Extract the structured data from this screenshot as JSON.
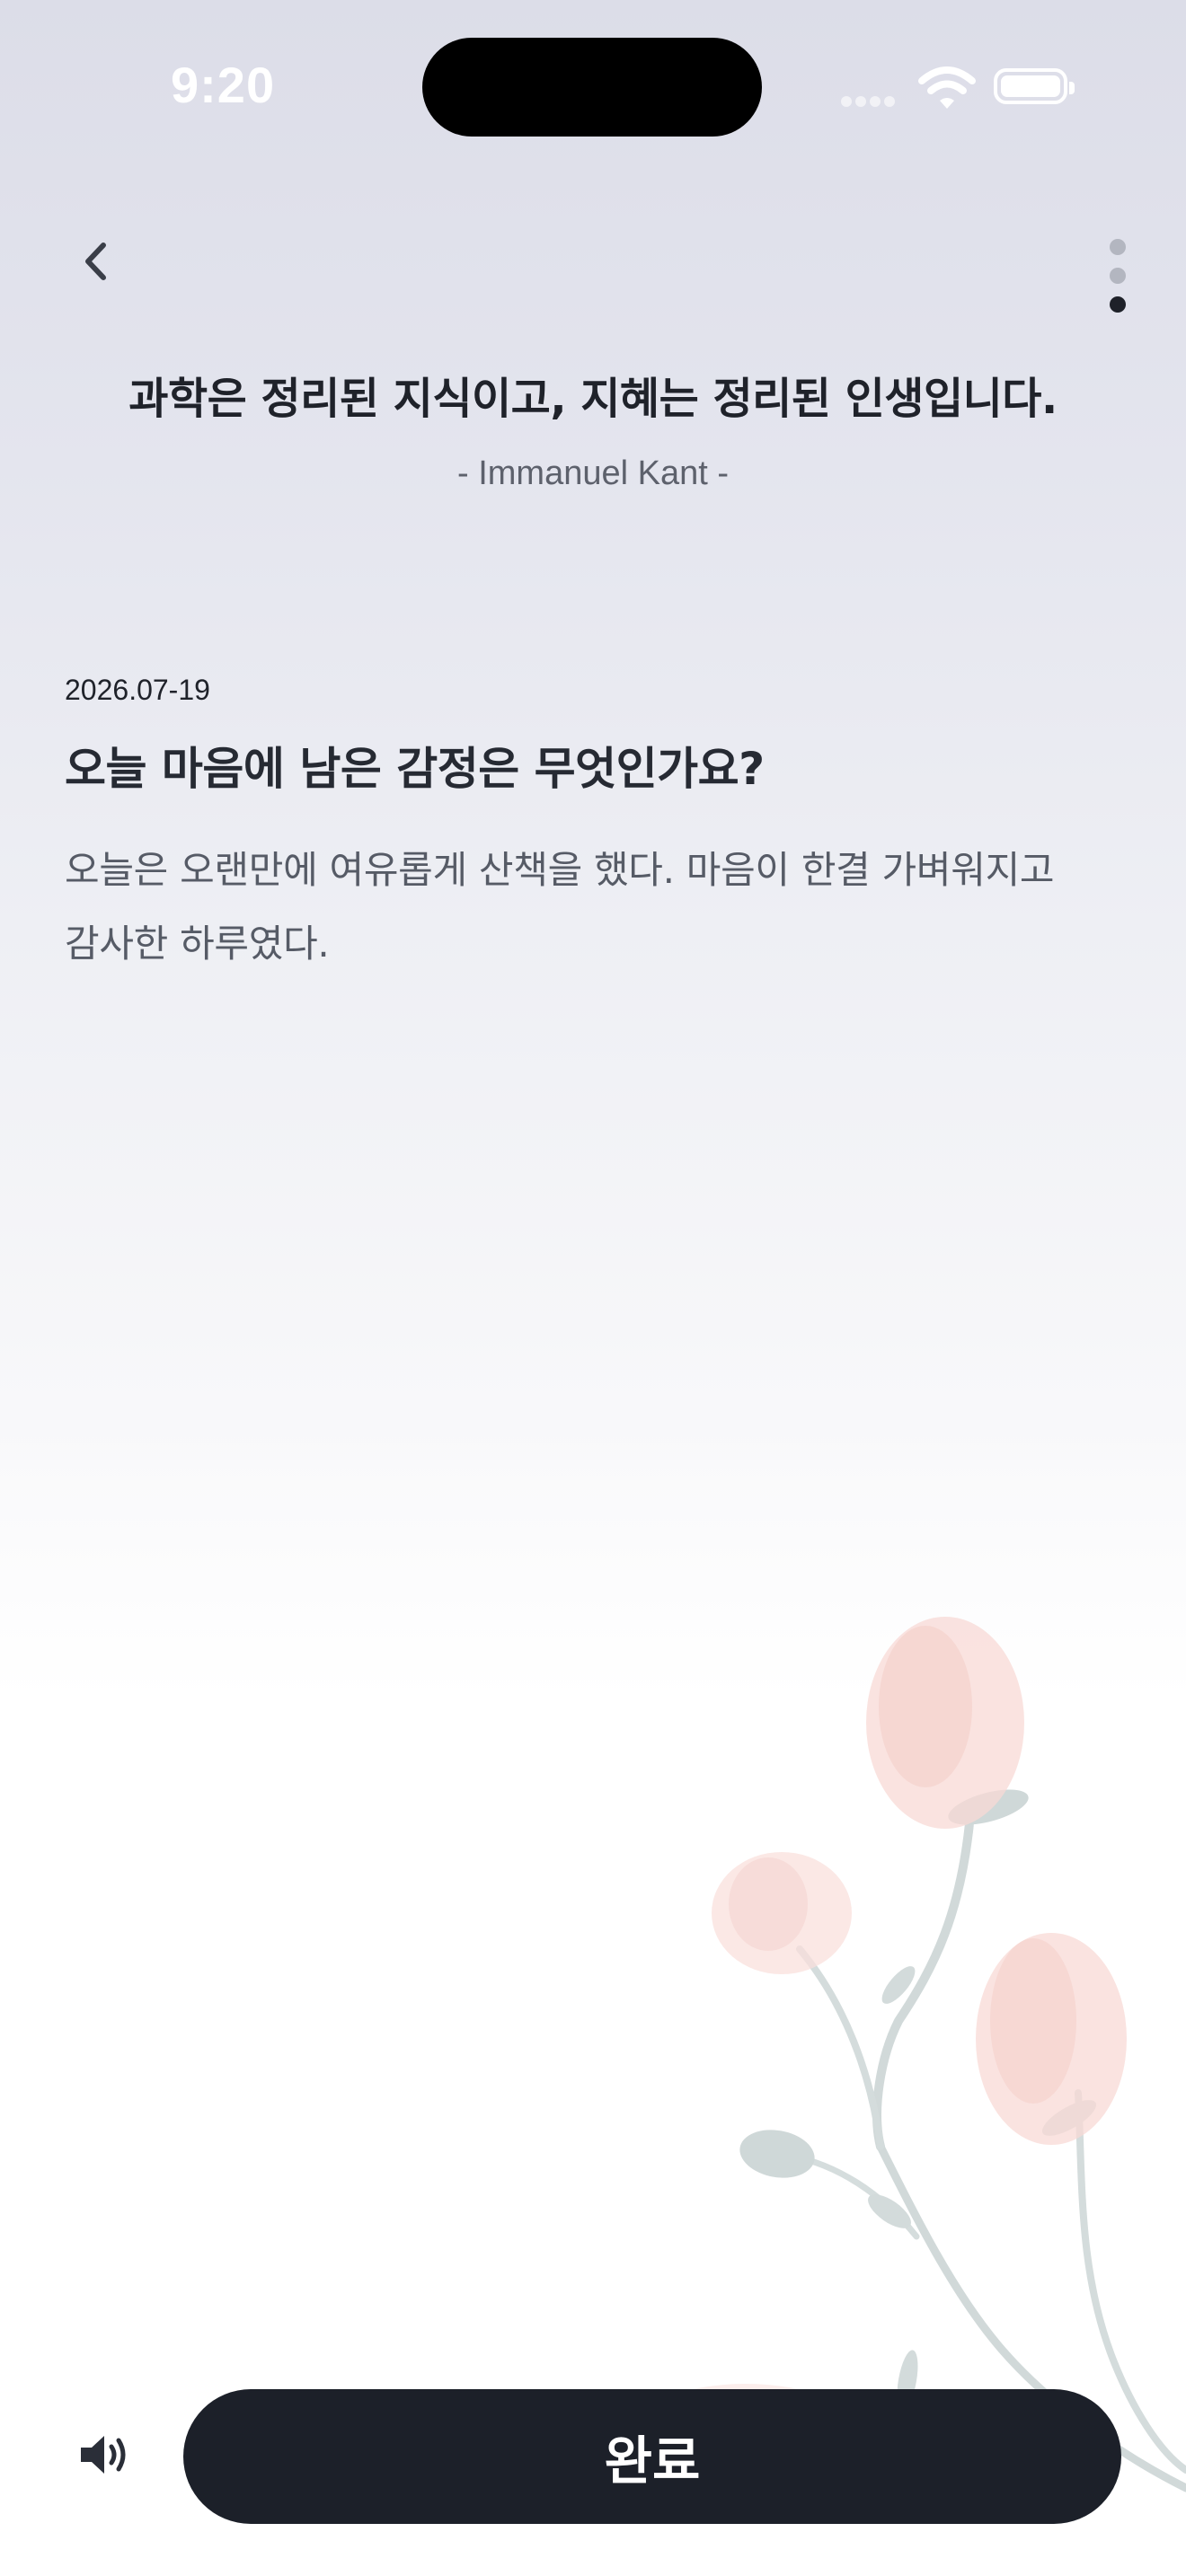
{
  "status_bar": {
    "time": "9:20",
    "icons": [
      "cellular-signal-icon",
      "wifi-icon",
      "battery-icon"
    ]
  },
  "nav": {
    "back_icon": "chevron-left-icon",
    "page_indicator": {
      "count": 3,
      "active_index": 2
    }
  },
  "quote": {
    "text": "과학은 정리된 지식이고, 지혜는 정리된 인생입니다.",
    "author": "- Immanuel Kant -"
  },
  "entry": {
    "date": "2026.07-19",
    "question": "오늘 마음에 남은 감정은 무엇인가요?",
    "body": "오늘은 오랜만에 여유롭게 산책을 했다. 마음이 한결 가벼워지고 감사한 하루였다."
  },
  "decoration": {
    "icon": "watercolor-flowers-illustration"
  },
  "bottom_bar": {
    "speaker_icon": "speaker-volume-icon",
    "done_label": "완료"
  },
  "colors": {
    "primary_button": "#1c2029",
    "text_primary": "#1f222a",
    "text_secondary": "#565b66",
    "dot_inactive": "#b3b6c0",
    "flower_pink": "#f4c9c3",
    "stem_gray": "#c4cfcf"
  }
}
